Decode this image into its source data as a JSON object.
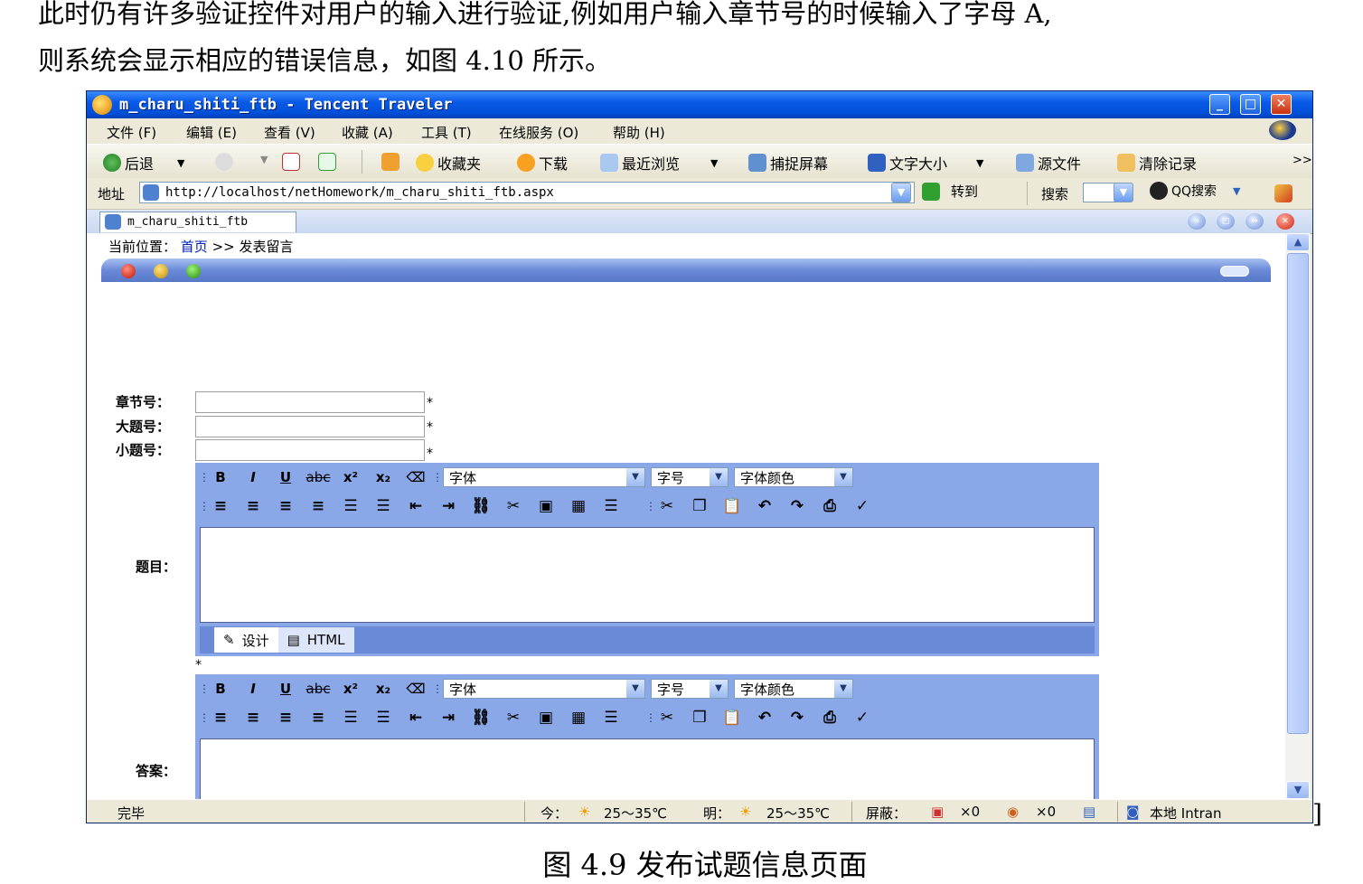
{
  "doc": {
    "line1": "此时仍有许多验证控件对用户的输入进行验证,例如用户输入章节号的时候输入了字母 A,",
    "line2": "则系统会显示相应的错误信息，如图 4.10 所示。",
    "caption": "图 4.9    发布试题信息页面",
    "bracket": "]"
  },
  "window": {
    "title": "m_charu_shiti_ftb - Tencent Traveler",
    "controls": {
      "minimize": "_",
      "maximize": "□",
      "close": "✕"
    }
  },
  "menu": [
    "文件 (F)",
    "编辑 (E)",
    "查看 (V)",
    "收藏 (A)",
    "工具 (T)",
    "在线服务 (O)",
    "帮助 (H)"
  ],
  "toolbar": {
    "back": "后退",
    "favorites": "收藏夹",
    "download": "下载",
    "recent": "最近浏览",
    "capture": "捕捉屏幕",
    "font_size": "文字大小",
    "source": "源文件",
    "clear": "清除记录",
    "more": ">>"
  },
  "address": {
    "label": "地址",
    "url": "http://localhost/netHomework/m_charu_shiti_ftb.aspx",
    "go": "转到",
    "search_label": "搜索",
    "qq_search": "QQ搜索"
  },
  "tab": {
    "title": "m_charu_shiti_ftb"
  },
  "breadcrumb": {
    "prefix": "当前位置：",
    "home": "首页",
    "sep_current": ">> 发表留言"
  },
  "form": {
    "chapter_label": "章节号：",
    "big_label": "大题号：",
    "small_label": "小题号：",
    "required": "*",
    "question_label": "题目：",
    "answer_label": "答案："
  },
  "editor": {
    "bold": "B",
    "italic": "I",
    "underline": "U",
    "strike": "abc",
    "superscript": "x²",
    "subscript": "x₂",
    "font_family": "字体",
    "font_size": "字号",
    "font_color": "字体颜色",
    "design_tab": "设计",
    "html_tab": "HTML"
  },
  "status": {
    "done": "完毕",
    "today": "今：",
    "today_temp": "25～35℃",
    "tomorrow": "明：",
    "tomorrow_temp": "25～35℃",
    "block": "屏蔽：",
    "count1": "×0",
    "count2": "×0",
    "zone": "本地 Intran"
  },
  "colors": {
    "titlebar": "#0050d8",
    "accent": "#8aa8e8",
    "link": "#0020c0"
  }
}
